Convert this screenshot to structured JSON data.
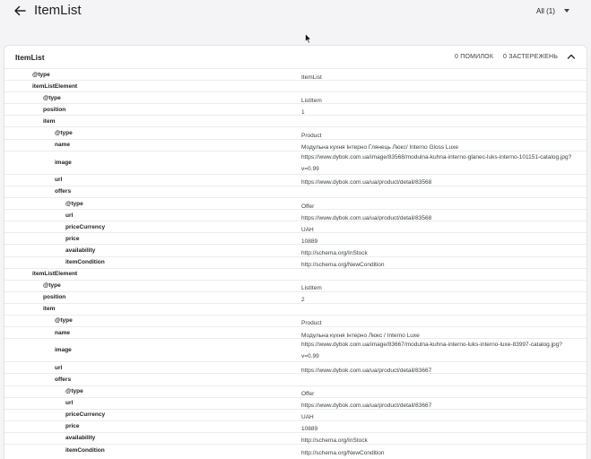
{
  "header": {
    "title": "ItemList",
    "filter_label": "All (1)"
  },
  "card": {
    "title": "ItemList",
    "errors_label": "0 ПОМИЛОК",
    "warnings_label": "0 ЗАСТЕРЕЖЕНЬ"
  },
  "rows": [
    {
      "key": "@type",
      "value": "ItemList"
    },
    {
      "key": "itemListElement",
      "value": ""
    },
    {
      "key": "@type",
      "value": "ListItem"
    },
    {
      "key": "position",
      "value": "1"
    },
    {
      "key": "item",
      "value": ""
    },
    {
      "key": "@type",
      "value": "Product"
    },
    {
      "key": "name",
      "value": "Модульна кухня Інтерно Глянець Люкс/ Interno Gloss Luxe"
    },
    {
      "key": "image",
      "value": "https://www.dybok.com.ua/image/83568/modulna-kuhna-interno-glanec-luks-interno-101151-catalog.jpg?v=0.99"
    },
    {
      "key": "url",
      "value": "https://www.dybok.com.ua/ua/product/detail/83568"
    },
    {
      "key": "offers",
      "value": ""
    },
    {
      "key": "@type",
      "value": "Offer"
    },
    {
      "key": "url",
      "value": "https://www.dybok.com.ua/ua/product/detail/83568"
    },
    {
      "key": "priceCurrency",
      "value": "UAH"
    },
    {
      "key": "price",
      "value": "10889"
    },
    {
      "key": "availability",
      "value": "http://schema.org/InStock"
    },
    {
      "key": "itemCondition",
      "value": "http://schema.org/NewCondition"
    },
    {
      "key": "itemListElement",
      "value": ""
    },
    {
      "key": "@type",
      "value": "ListItem"
    },
    {
      "key": "position",
      "value": "2"
    },
    {
      "key": "item",
      "value": ""
    },
    {
      "key": "@type",
      "value": "Product"
    },
    {
      "key": "name",
      "value": "Модульна кухня Інтерно Люкс / Interno Luxe"
    },
    {
      "key": "image",
      "value": "https://www.dybok.com.ua/image/83667/modulna-kuhna-interno-luks-interno-luxe-83997-catalog.jpg?v=0.99"
    },
    {
      "key": "url",
      "value": "https://www.dybok.com.ua/ua/product/detail/83667"
    },
    {
      "key": "offers",
      "value": ""
    },
    {
      "key": "@type",
      "value": "Offer"
    },
    {
      "key": "url",
      "value": "https://www.dybok.com.ua/ua/product/detail/83667"
    },
    {
      "key": "priceCurrency",
      "value": "UAH"
    },
    {
      "key": "price",
      "value": "10889"
    },
    {
      "key": "availability",
      "value": "http://schema.org/InStock"
    },
    {
      "key": "itemCondition",
      "value": "http://schema.org/NewCondition"
    }
  ]
}
